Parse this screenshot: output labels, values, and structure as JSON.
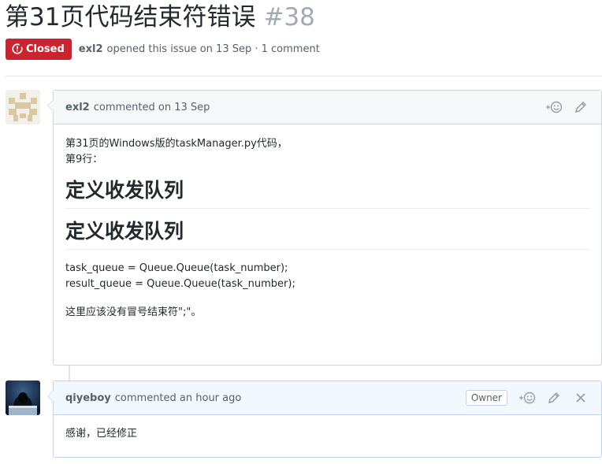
{
  "issue": {
    "title": "第31页代码结束符错误",
    "number": "#38",
    "state": "Closed",
    "author": "exl2",
    "meta_text": "opened this issue on 13 Sep · 1 comment"
  },
  "comments": [
    {
      "author": "exl2",
      "action": "commented on 13 Sep",
      "body": {
        "line1": "第31页的Windows版的taskManager.py代码，",
        "line2": "第9行：",
        "heading1": "定义收发队列",
        "heading2": "定义收发队列",
        "code1": "task_queue = Queue.Queue(task_number);",
        "code2": "result_queue = Queue.Queue(task_number);",
        "note": "这里应该没有冒号结束符\";\"。"
      }
    },
    {
      "author": "qiyeboy",
      "action": "commented an hour ago",
      "badge": "Owner",
      "body": {
        "text": "感谢，已经修正"
      }
    }
  ],
  "icons": {
    "state": "closed-issue-icon",
    "reaction": "add-reaction-icon",
    "edit": "pencil-icon",
    "delete": "close-icon"
  },
  "colors": {
    "closed_state": "#cb2431",
    "owner_header": "#f1f8ff",
    "header": "#f6f8fa"
  }
}
